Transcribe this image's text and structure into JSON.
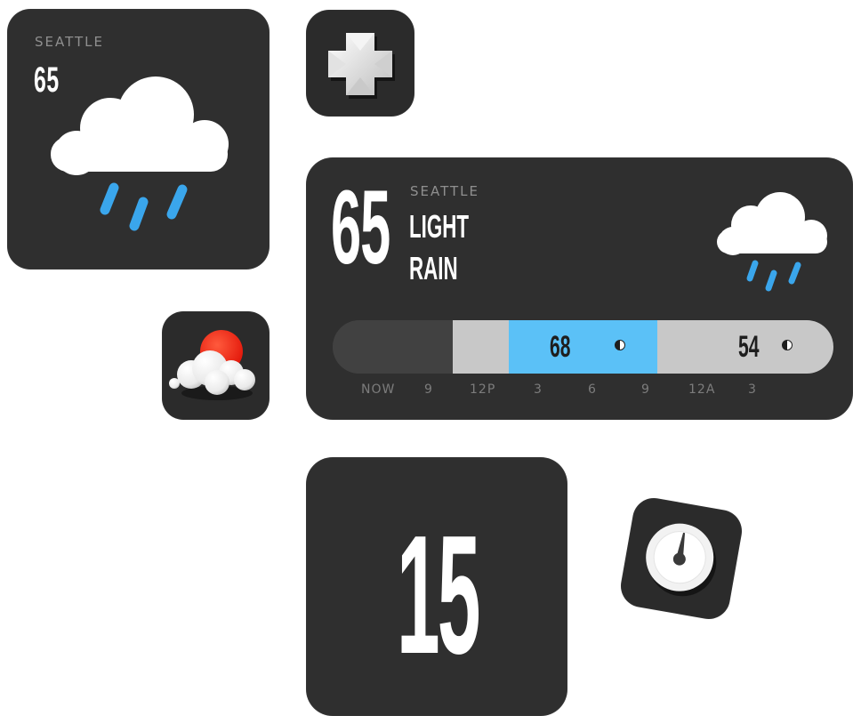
{
  "small_widget": {
    "city": "SEATTLE",
    "temperature": "65",
    "icon": "rain-cloud-icon"
  },
  "plus_app": {
    "icon": "plus-icon"
  },
  "cloudsun_app": {
    "icon": "cloud-sun-icon"
  },
  "large_widget": {
    "temperature": "65",
    "city": "SEATTLE",
    "condition_line1": "LIGHT",
    "condition_line2": "RAIN",
    "icon": "rain-cloud-icon",
    "timeline": {
      "high": "68",
      "low": "54",
      "ticks": [
        "NOW",
        "9",
        "12P",
        "3",
        "6",
        "9",
        "12A",
        "3"
      ],
      "colors": {
        "rain": "#5bc1f7",
        "cloud": "#c8c8c8",
        "past": "#414141"
      }
    }
  },
  "date_tile": {
    "day": "15"
  },
  "gauge_app": {
    "icon": "gauge-icon"
  },
  "colors": {
    "tile": "#2f2f2f",
    "rain_blue": "#4aa8ec",
    "sun_red": "#ff2a1a"
  }
}
